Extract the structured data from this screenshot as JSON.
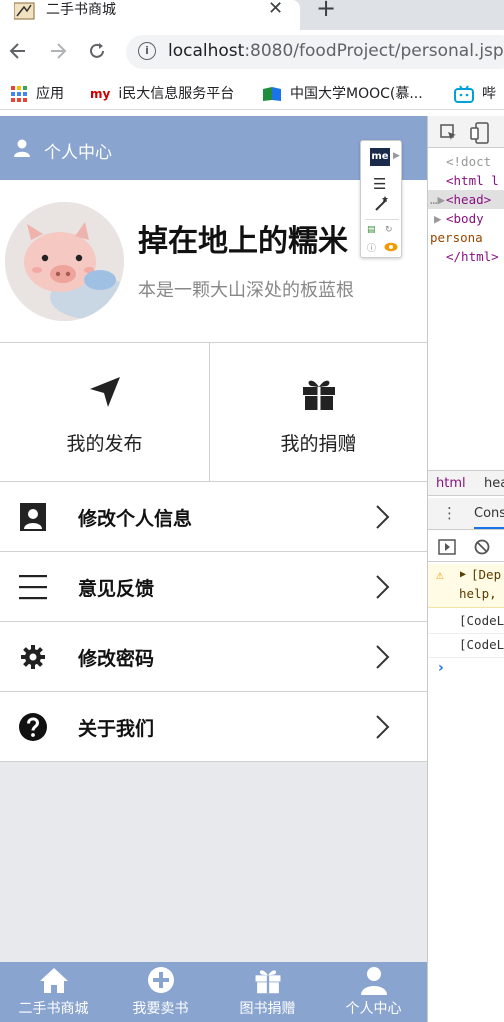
{
  "browser": {
    "tab_title": "二手书商城",
    "tab_close": "✕",
    "new_tab": "+",
    "url_host": "localhost",
    "url_rest": ":8080/foodProject/personal.jsp",
    "bookmarks": [
      {
        "label": "应用"
      },
      {
        "label": "i民大信息服务平台",
        "badge": "my"
      },
      {
        "label": "中国大学MOOC(慕..."
      },
      {
        "label": "哔"
      }
    ]
  },
  "header": {
    "title": "个人中心"
  },
  "profile": {
    "username": "掉在地上的糯米",
    "bio": "本是一颗大山深处的板蓝根"
  },
  "grid": [
    {
      "label": "我的发布",
      "icon": "send-icon"
    },
    {
      "label": "我的捐赠",
      "icon": "gift-icon"
    }
  ],
  "menu": [
    {
      "label": "修改个人信息",
      "icon": "user-card-icon"
    },
    {
      "label": "意见反馈",
      "icon": "menu-lines-icon"
    },
    {
      "label": "修改密码",
      "icon": "gear-icon"
    },
    {
      "label": "关于我们",
      "icon": "question-icon"
    }
  ],
  "bottom_nav": [
    {
      "label": "二手书商城",
      "icon": "home-icon"
    },
    {
      "label": "我要卖书",
      "icon": "plus-circle-icon"
    },
    {
      "label": "图书捐赠",
      "icon": "gift-icon"
    },
    {
      "label": "个人中心",
      "icon": "user-icon"
    }
  ],
  "extension": {
    "logo": "me"
  },
  "devtools": {
    "lines": [
      "<!doct",
      "<html l",
      "<head>",
      "<body",
      "persona",
      "</html>"
    ],
    "panel_tabs": [
      "html",
      "hea"
    ],
    "console_tab": "Cons",
    "warn_text_1": "[Dep",
    "warn_text_2": "help,",
    "log_1": "[CodeL",
    "log_2": "[CodeL"
  },
  "colors": {
    "app_header": "#8aa4d0",
    "bottom_nav": "#8aa4d0",
    "page_bg": "#e8e9ec"
  }
}
